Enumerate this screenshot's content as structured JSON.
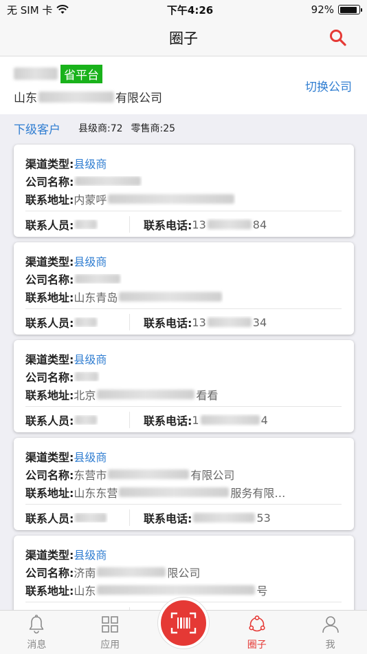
{
  "status": {
    "carrier": "无 SIM 卡",
    "time": "下午4:26",
    "battery": "92%",
    "battery_level": 0.92
  },
  "nav": {
    "title": "圈子",
    "search_icon": "search-icon"
  },
  "company": {
    "badge": "省平台",
    "name_prefix": "山东",
    "name_suffix": "有限公司",
    "switch_label": "切换公司"
  },
  "subheader": {
    "title": "下级客户",
    "county_count": "县级商:72",
    "retail_count": "零售商:25"
  },
  "labels": {
    "channel": "渠道类型:",
    "company": "公司名称:",
    "address": "联系地址:",
    "contact": "联系人员:",
    "phone": "联系电话:"
  },
  "cards": [
    {
      "channel": "县级商",
      "company": "",
      "address_prefix": "内蒙呼",
      "address_suffix": "",
      "phone_prefix": "13",
      "phone_suffix": "84"
    },
    {
      "channel": "县级商",
      "company": "",
      "address_prefix": "山东青岛",
      "address_suffix": "",
      "phone_prefix": "13",
      "phone_suffix": "34"
    },
    {
      "channel": "县级商",
      "company": "",
      "address_prefix": "北京",
      "address_suffix": "看看",
      "phone_prefix": "1",
      "phone_suffix": "4"
    },
    {
      "channel": "县级商",
      "company_prefix": "东营市",
      "company_suffix": "有限公司",
      "address_prefix": "山东东营",
      "address_suffix": "服务有限…",
      "phone_prefix": "",
      "phone_suffix": "53"
    },
    {
      "channel": "县级商",
      "company_prefix": "济南",
      "company_suffix": "限公司",
      "address_prefix": "山东",
      "address_suffix": "号",
      "phone_prefix": "",
      "phone_suffix": ""
    }
  ],
  "tabs": [
    {
      "label": "消息",
      "icon": "bell-icon"
    },
    {
      "label": "应用",
      "icon": "grid-icon"
    },
    {
      "label": "",
      "icon": "scan-icon"
    },
    {
      "label": "圈子",
      "icon": "circle-network-icon"
    },
    {
      "label": "我",
      "icon": "person-icon"
    }
  ],
  "colors": {
    "accent_red": "#e53935",
    "link_blue": "#2f7dd1",
    "badge_green": "#19b21b"
  }
}
